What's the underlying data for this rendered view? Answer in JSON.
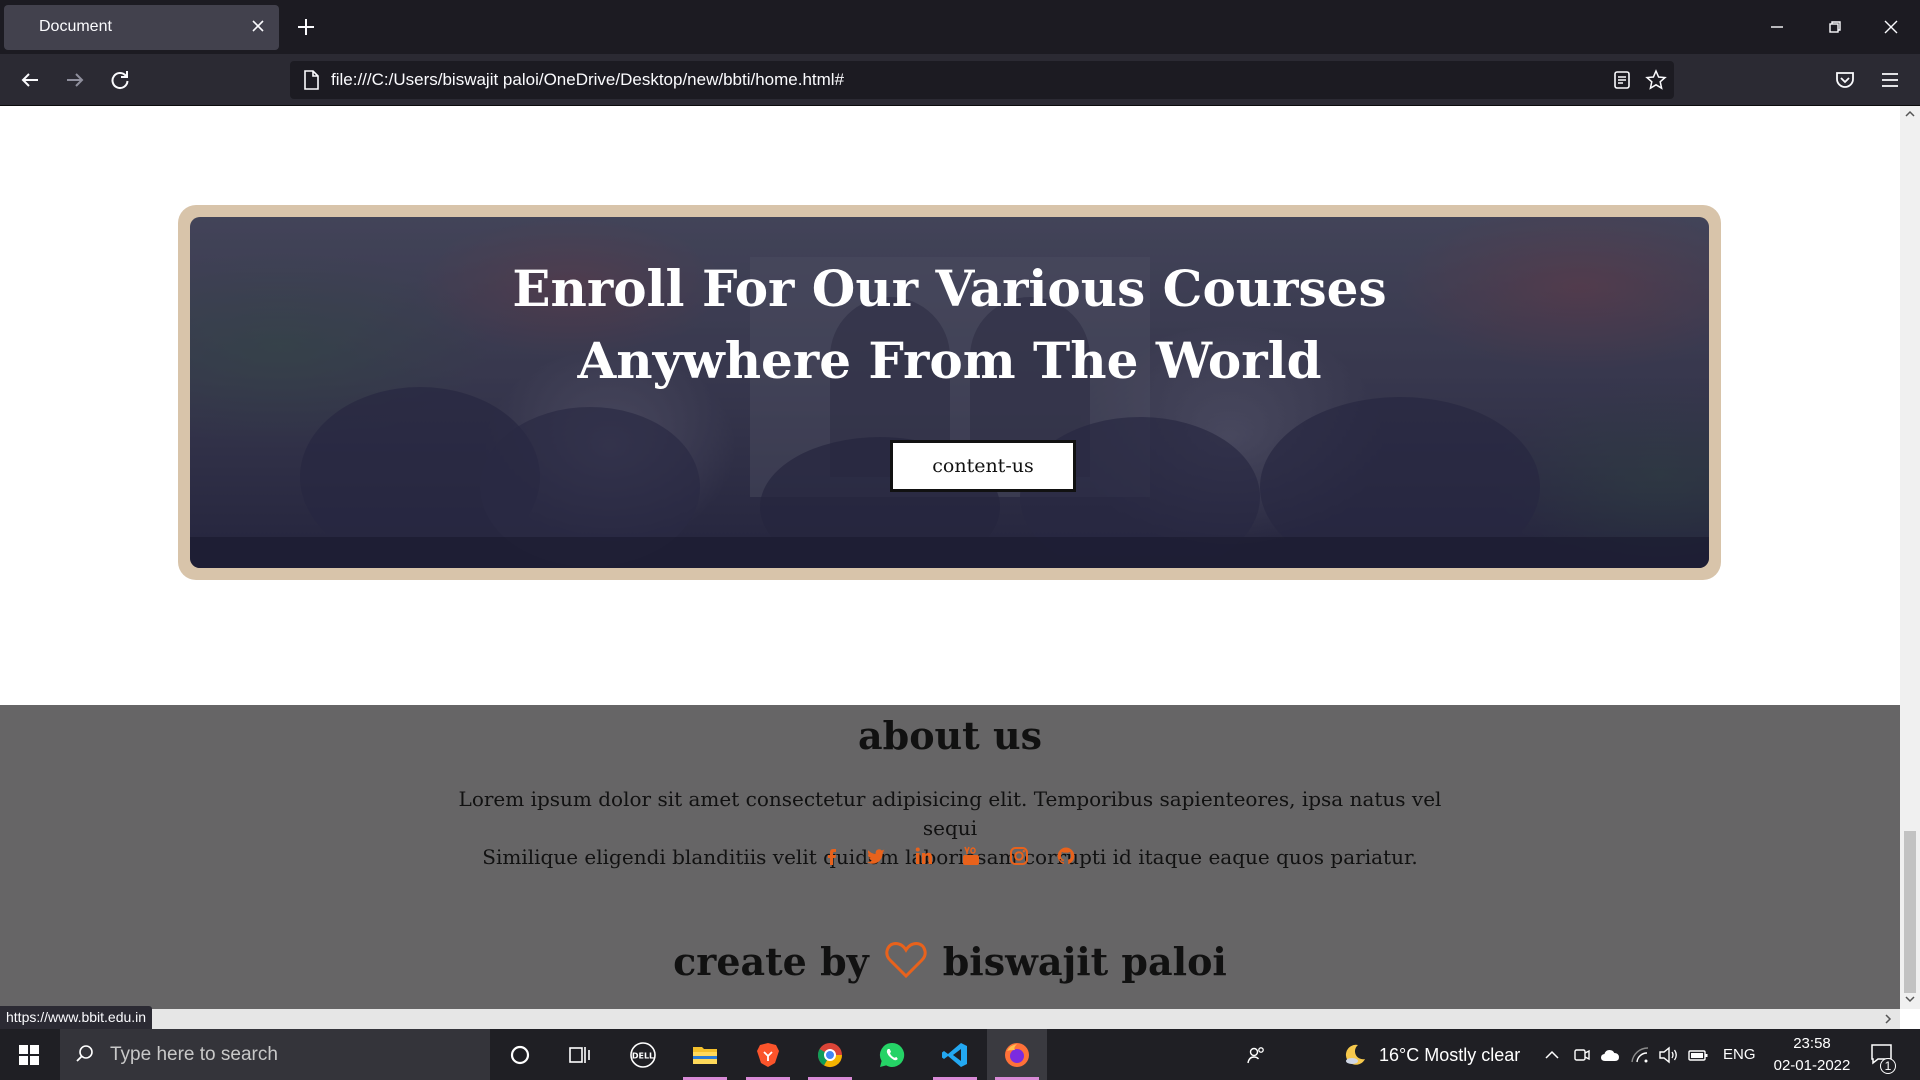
{
  "browser": {
    "tab_title": "Document",
    "url": "file:///C:/Users/biswajit paloi/OneDrive/Desktop/new/bbti/home.html#",
    "status_link": "https://www.bbit.edu.in"
  },
  "banner": {
    "title_line1": "Enroll For Our Various Courses",
    "title_line2": "Anywhere From The World",
    "button_label": "content-us"
  },
  "about": {
    "title": "about us",
    "text_line1": "Lorem ipsum dolor sit amet consectetur adipisicing elit. Temporibus sapienteores, ipsa natus vel sequi",
    "text_line2": "Similique eligendi blanditiis velit quidem laboriosam corrupti id itaque eaque quos pariatur.",
    "social_icons": [
      "facebook-icon",
      "twitter-icon",
      "linkedin-icon",
      "youtube-icon",
      "instagram-icon",
      "github-icon"
    ],
    "accent_color": "#e8621c"
  },
  "footer": {
    "prefix": "create by",
    "author": "biswajit paloi"
  },
  "taskbar": {
    "search_placeholder": "Type here to search",
    "weather": "16°C  Mostly clear",
    "language": "ENG",
    "time": "23:58",
    "date": "02-01-2022",
    "notification_count": "1"
  }
}
